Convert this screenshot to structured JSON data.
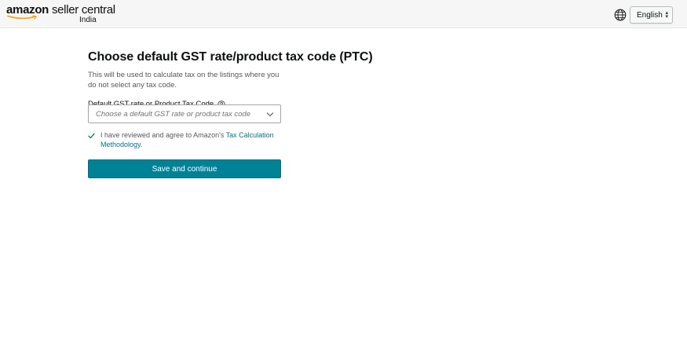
{
  "header": {
    "logo": {
      "brand": "amazon",
      "product": "seller central",
      "region": "India"
    },
    "language": {
      "selected": "English",
      "globe_icon": "globe-icon",
      "caret_icon": "updown-caret-icon"
    }
  },
  "form": {
    "title": "Choose default GST rate/product tax code (PTC)",
    "description": "This will be used to calculate tax on the listings where you do not select any tax code.",
    "field_label": "Default GST rate or Product Tax Code",
    "help_icon": "question-circle-icon",
    "select_placeholder": "Choose a default GST rate or product tax code",
    "agreement": {
      "text": "I have reviewed and agree to Amazon's ",
      "link": "Tax Calculation Methodology",
      "suffix": "."
    },
    "save_label": "Save and continue"
  },
  "colors": {
    "primary_button": "#008296",
    "link": "#007185",
    "check": "#067d62"
  }
}
